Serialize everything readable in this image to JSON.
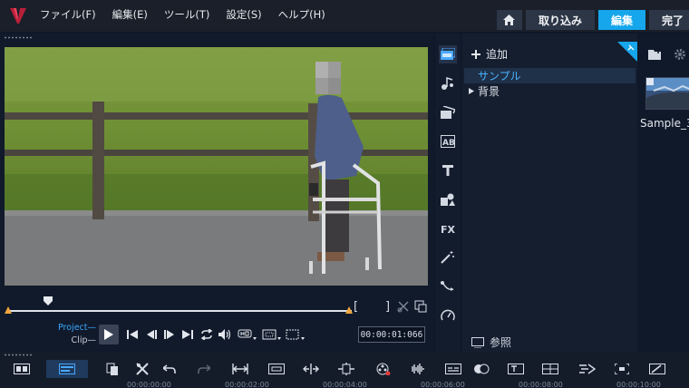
{
  "menu": {
    "items": [
      "ファイル(F)",
      "編集(E)",
      "ツール(T)",
      "設定(S)",
      "ヘルプ(H)"
    ]
  },
  "top_tabs": {
    "capture": "取り込み",
    "edit": "編集",
    "share": "完了"
  },
  "player": {
    "mode_project": "Project",
    "mode_clip": "Clip",
    "timecode": "00:00:01:066",
    "mark_in": "[",
    "mark_out": "]"
  },
  "library": {
    "add_label": "追加",
    "folders": [
      "サンプル",
      "背景"
    ],
    "browse_label": "参照"
  },
  "media": {
    "thumbnail_label": "Sample_3"
  },
  "tools": [
    "media-icon",
    "instant-project-icon",
    "transition-icon",
    "title-icon",
    "text-icon",
    "graphics-icon",
    "fx-icon",
    "filter-icon",
    "path-icon",
    "gauge-icon"
  ],
  "timeline": {
    "ruler": [
      "00:00:00:00",
      "00:00:02:00",
      "00:00:04:00",
      "00:00:06:00",
      "00:00:08:00",
      "00:00:10:00"
    ]
  },
  "colors": {
    "accent": "#15a6ec",
    "project_label": "#3aa8ff",
    "library_selected": "#4ab3ff"
  }
}
